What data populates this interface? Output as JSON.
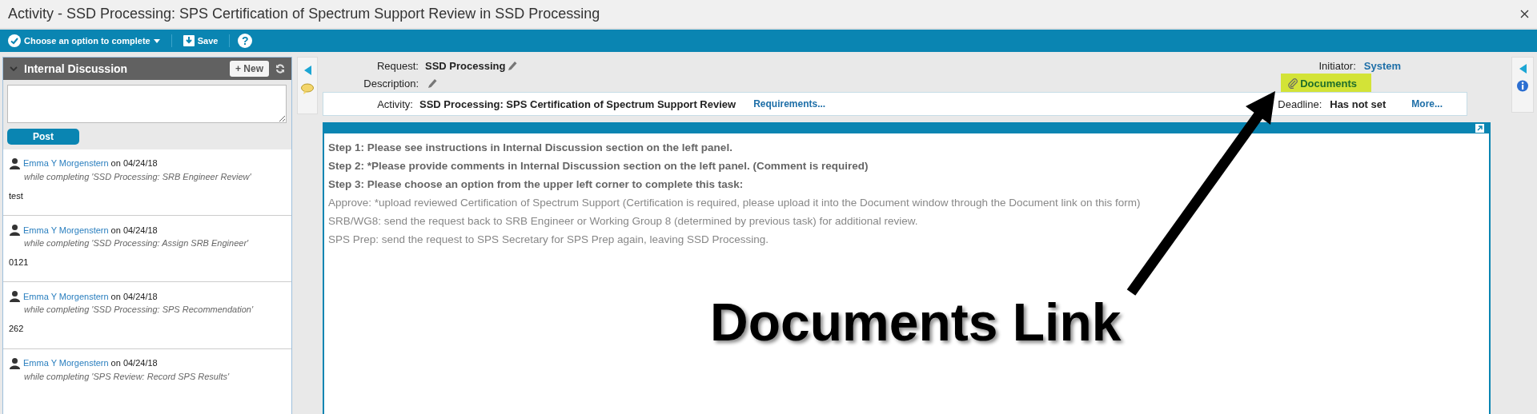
{
  "window": {
    "title": "Activity - SSD Processing: SPS Certification of Spectrum Support Review in SSD Processing"
  },
  "toolbar": {
    "complete_menu": "Choose an option to complete",
    "save": "Save",
    "help": "?"
  },
  "discussion": {
    "title": "Internal Discussion",
    "new_button": "+ New",
    "post_button": "Post",
    "comments": [
      {
        "author": "Emma Y Morgenstern",
        "date": "on 04/24/18",
        "context": "while completing 'SSD Processing: SRB Engineer Review'",
        "body": "test"
      },
      {
        "author": "Emma Y Morgenstern",
        "date": "on 04/24/18",
        "context": "while completing 'SSD Processing: Assign SRB Engineer'",
        "body": "0121"
      },
      {
        "author": "Emma Y Morgenstern",
        "date": "on 04/24/18",
        "context": "while completing 'SSD Processing: SPS Recommendation'",
        "body": "262"
      },
      {
        "author": "Emma Y Morgenstern",
        "date": "on 04/24/18",
        "context": "while completing 'SPS Review: Record SPS Results'"
      }
    ]
  },
  "header": {
    "request_label": "Request:",
    "request_value": "SSD Processing",
    "description_label": "Description:",
    "initiator_label": "Initiator:",
    "initiator_value": "System",
    "documents_link": "Documents",
    "activity_label": "Activity:",
    "activity_value": "SSD Processing: SPS Certification of Spectrum Support Review",
    "requirements_link": "Requirements...",
    "deadline_label": "Deadline:",
    "deadline_value": "Has not set",
    "more_link": "More..."
  },
  "instructions": [
    {
      "kind": "step",
      "text": "Step 1: Please see instructions in Internal Discussion section on the left panel."
    },
    {
      "kind": "step",
      "text": "Step 2: *Please provide comments in Internal Discussion section on the left panel. (Comment is required)"
    },
    {
      "kind": "step",
      "text": "Step 3: Please choose an option from the upper left corner to complete this task:"
    },
    {
      "kind": "note",
      "text": "Approve: *upload reviewed Certification of Spectrum Support (Certification is required, please upload it into the Document window through the Document link on this form)"
    },
    {
      "kind": "note",
      "text": "SRB/WG8: send the request back to SRB Engineer or Working Group 8 (determined by previous task) for additional review."
    },
    {
      "kind": "note",
      "text": "SPS Prep: send the request to SPS Secretary for SPS Prep again, leaving SSD Processing."
    }
  ],
  "annotation": {
    "text": "Documents Link"
  }
}
